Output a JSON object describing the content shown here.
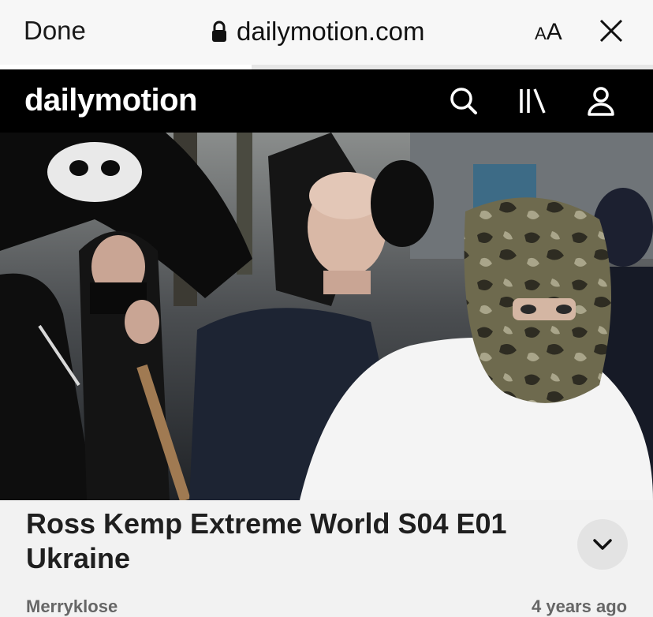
{
  "browser": {
    "done_label": "Done",
    "url": "dailymotion.com",
    "text_size_label_small": "A",
    "text_size_label_large": "A",
    "page_load_progress": 0.385
  },
  "site": {
    "logo_text": "dailymotion",
    "icons": [
      "search-icon",
      "library-icon",
      "user-icon"
    ]
  },
  "video": {
    "title": "Ross Kemp Extreme World S04 E01 Ukraine",
    "channel": "Merryklose",
    "age": "4 years ago"
  },
  "colors": {
    "header_bg": "#000000",
    "browser_bar_bg": "#f7f7f7",
    "page_bg": "#f2f2f2"
  }
}
